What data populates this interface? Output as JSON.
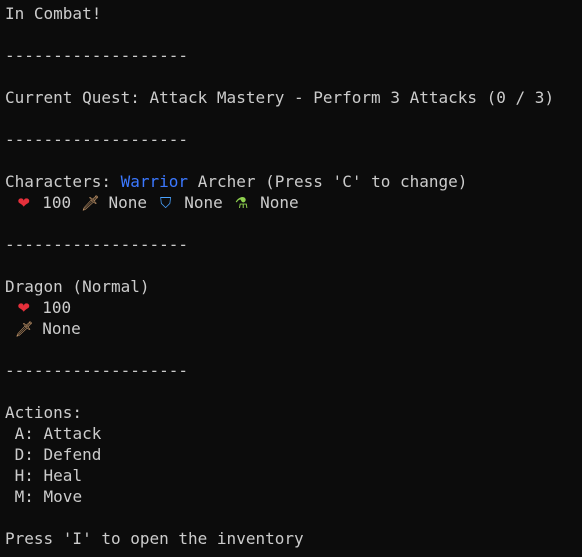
{
  "status": "In Combat!",
  "divider": "-------------------",
  "quest": {
    "text": "Current Quest: Attack Mastery - Perform 3 Attacks (0 / 3)"
  },
  "characters": {
    "prefix": "Characters:",
    "selected": "Warrior",
    "other": "Archer",
    "hint": "(Press 'C' to change)",
    "stats": {
      "health": "100",
      "weapon": "None",
      "armor": "None",
      "potion": "None"
    }
  },
  "enemy": {
    "name": "Dragon (Normal)",
    "health": "100",
    "weapon": "None"
  },
  "actions": {
    "title": "Actions:",
    "items": [
      {
        "label": "A: Attack"
      },
      {
        "label": "D: Defend"
      },
      {
        "label": "H: Heal"
      },
      {
        "label": "M: Move"
      }
    ]
  },
  "inventory_hint": "Press 'I' to open the inventory",
  "colors": {
    "background": "#0c0c0c",
    "text": "#cccccc",
    "selected_character": "#3b78ff"
  },
  "icons": {
    "health": "heart-icon",
    "weapon": "sword-icon",
    "armor": "shield-icon",
    "potion": "potion-icon"
  }
}
